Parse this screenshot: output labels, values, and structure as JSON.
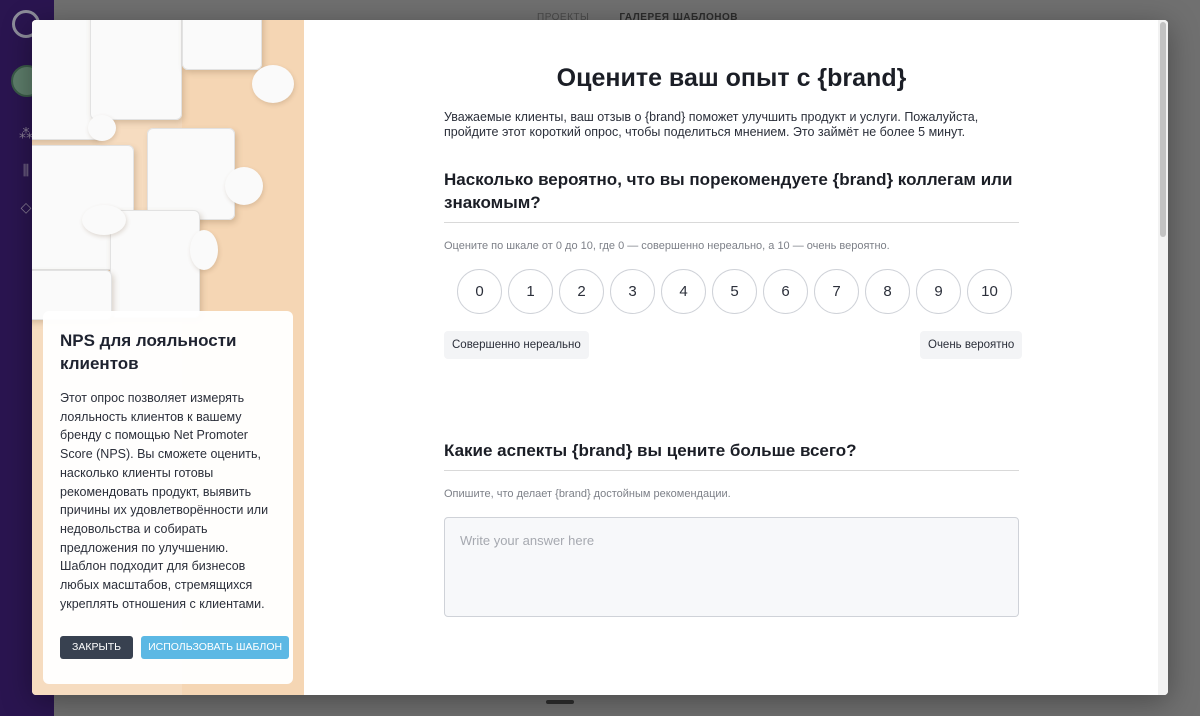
{
  "app": {
    "tabs": [
      "ПРОЕКТЫ",
      "ГАЛЕРЕЯ ШАБЛОНОВ"
    ]
  },
  "template_card": {
    "title": "NPS для лояльности клиентов",
    "description": "Этот опрос позволяет измерять лояльность клиентов к вашему бренду с помощью Net Promoter Score (NPS). Вы сможете оценить, насколько клиенты готовы рекомендовать продукт, выявить причины их удовлетворённости или недовольства и собирать предложения по улучшению. Шаблон подходит для бизнесов любых масштабов, стремящихся укреплять отношения с клиентами.",
    "close_label": "ЗАКРЫТЬ",
    "use_label": "ИСПОЛЬЗОВАТЬ ШАБЛОН"
  },
  "survey": {
    "title": "Оцените ваш опыт с {brand}",
    "intro": "Уважаемые клиенты, ваш отзыв о {brand} поможет улучшить продукт и услуги. Пожалуйста, пройдите этот короткий опрос, чтобы поделиться мнением. Это займёт не более 5 минут.",
    "q1": {
      "title": "Насколько вероятно, что вы порекомендуете {brand} коллегам или знакомым?",
      "hint": "Оцените по шкале от 0 до 10, где 0 — совершенно нереально, а 10 — очень вероятно.",
      "scale": [
        "0",
        "1",
        "2",
        "3",
        "4",
        "5",
        "6",
        "7",
        "8",
        "9",
        "10"
      ],
      "low_label": "Совершенно нереально",
      "high_label": "Очень вероятно"
    },
    "q2": {
      "title": "Какие аспекты {brand} вы цените больше всего?",
      "hint": "Опишите, что делает {brand} достойным рекомендации.",
      "placeholder": "Write your answer here"
    }
  },
  "colors": {
    "sidebar": "#2a1550",
    "primary_button": "#384150",
    "accent_button": "#5cb8e4",
    "hero_background": "#f5d6b4"
  }
}
